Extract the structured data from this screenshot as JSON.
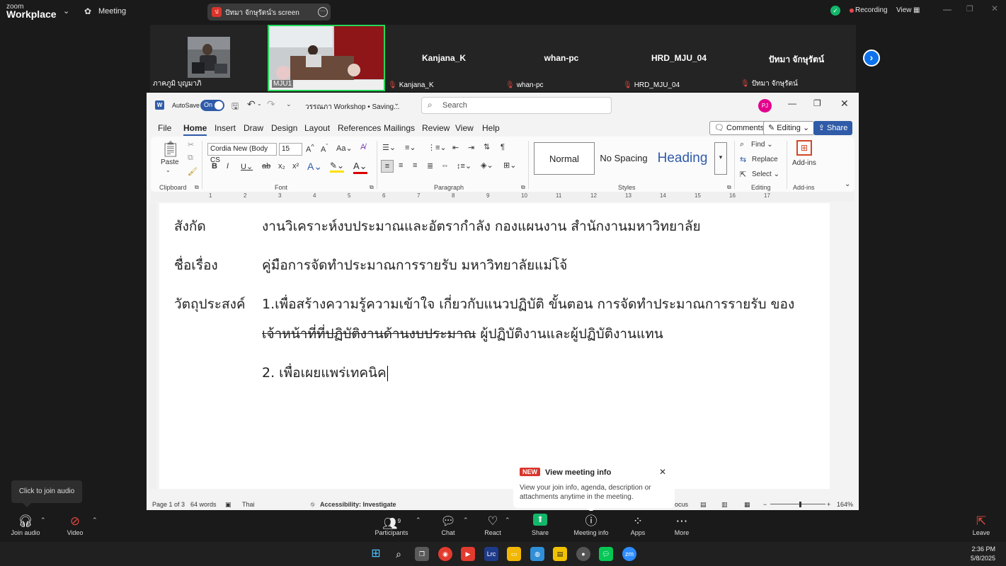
{
  "topbar": {
    "logo_line1": "zoom",
    "logo_line2": "Workplace",
    "meeting_label": "Meeting",
    "screen_share_label": "ปัทมา จักษุรัตน์'s screen",
    "screen_share_initial": "ป",
    "recording_label": "Recording",
    "view_label": "View"
  },
  "participants": [
    {
      "name": "",
      "label": "ภาคภูมิ บุญมาภิ",
      "muted": false,
      "has_video": true
    },
    {
      "name": "",
      "label": "MJU1",
      "muted": false,
      "has_video": true,
      "active": true
    },
    {
      "name": "Kanjana_K",
      "label": "Kanjana_K",
      "muted": true,
      "has_video": false
    },
    {
      "name": "whan-pc",
      "label": "whan-pc",
      "muted": true,
      "has_video": false
    },
    {
      "name": "HRD_MJU_04",
      "label": "HRD_MJU_04",
      "muted": true,
      "has_video": false
    },
    {
      "name": "ปัทมา จักษุรัตน์",
      "label": "ปัทมา จักษุรัตน์",
      "muted": true,
      "has_video": false
    }
  ],
  "word": {
    "autosave_label": "AutoSave",
    "autosave_state": "On",
    "doc_title": "วรรณภา Workshop • Saving...",
    "search_placeholder": "Search",
    "avatar_initials": "PJ",
    "menu": [
      "File",
      "Home",
      "Insert",
      "Draw",
      "Design",
      "Layout",
      "References",
      "Mailings",
      "Review",
      "View",
      "Help"
    ],
    "active_menu": "Home",
    "comments_label": "Comments",
    "editing_label": "Editing",
    "share_label": "Share",
    "ribbon": {
      "paste_label": "Paste",
      "clipboard_label": "Clipboard",
      "font_name": "Cordia New (Body CS",
      "font_size": "15",
      "font_label": "Font",
      "paragraph_label": "Paragraph",
      "styles": [
        "Normal",
        "No Spacing",
        "Heading"
      ],
      "styles_label": "Styles",
      "find_label": "Find",
      "replace_label": "Replace",
      "select_label": "Select",
      "editing_group_label": "Editing",
      "addins_label": "Add-ins",
      "addins_group_label": "Add-ins"
    },
    "ruler_numbers": [
      "1",
      "2",
      "3",
      "4",
      "5",
      "6",
      "7",
      "8",
      "9",
      "10",
      "11",
      "12",
      "13",
      "14",
      "15",
      "16",
      "17"
    ],
    "document": {
      "row1_label": "สังกัด",
      "row1_value": "งานวิเคราะห์งบประมาณและอัตรากำลัง กองแผนงาน สำนักงานมหาวิทยาลัย",
      "row2_label": "ชื่อเรื่อง",
      "row2_value": "คู่มือการจัดทำประมาณการรายรับ มหาวิทยาลัยแม่โจ้",
      "row3_label": "วัตถุประสงค์",
      "row3_line1": "1.เพื่อสร้างความรู้ความเข้าใจ เกี่ยวกับแนวปฏิบัติ ขั้นตอน การจัดทำประมาณการรายรับ ของ",
      "row3_line2_strike": "เจ้าหน้าที่ที่ปฏิบัติงานด้านงบประมาณ",
      "row3_line2_rest": " ผู้ปฏิบัติงานและผู้ปฏิบัติงานแทน",
      "row4_line": "2. เพื่อเผยแพร่เทคนิค"
    },
    "status": {
      "page": "Page 1 of 3",
      "words": "64 words",
      "language": "Thai",
      "accessibility": "Accessibility: Investigate",
      "focus": "ocus",
      "zoom": "164%"
    }
  },
  "popup": {
    "badge": "NEW",
    "title": "View meeting info",
    "body": "View your join info, agenda, description or attachments anytime in the meeting."
  },
  "tooltip": "Click to join audio",
  "controls": {
    "join_audio": "Join audio",
    "video": "Video",
    "participants": "Participants",
    "participants_count": "9",
    "chat": "Chat",
    "react": "React",
    "share": "Share",
    "meeting_info": "Meeting info",
    "apps": "Apps",
    "more": "More",
    "leave": "Leave"
  },
  "taskbar": {
    "time": "2:36 PM",
    "date": "5/8/2025"
  },
  "colors": {
    "zoom_blue": "#0e72ed",
    "word_blue": "#2f5ba8",
    "mute_red": "#e0483e",
    "share_green": "#12b76a",
    "recording_red": "#e5484d"
  }
}
